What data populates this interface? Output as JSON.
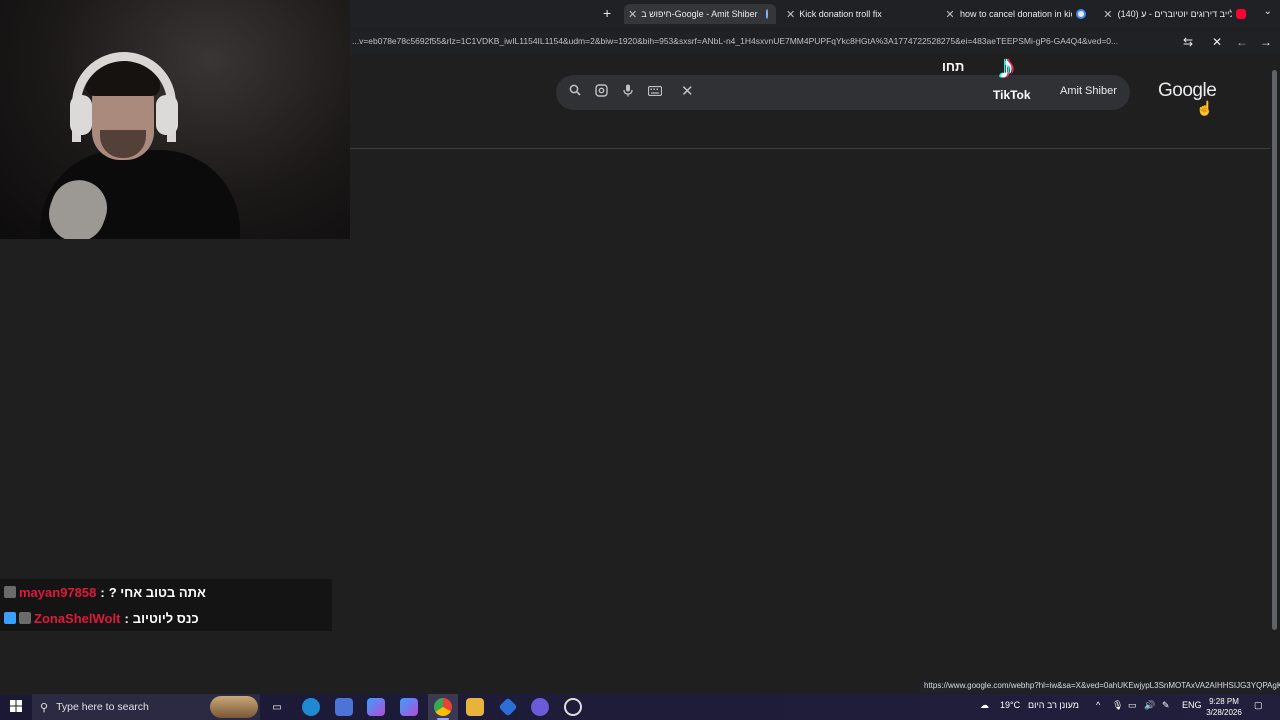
{
  "browser": {
    "tabs": [
      {
        "label": "חיפוש ב-Google - Amit Shiber",
        "active": true
      },
      {
        "label": "Kick donation troll fix",
        "active": false
      },
      {
        "label": "how to cancel donation in kick",
        "active": false
      },
      {
        "label": "(140) לייב דירוגים יוטיוברים - ע...",
        "active": false
      }
    ],
    "url": "...v=eb078e78c5692f55&rlz=1C1VDKB_iwIL1154IL1154&udm=2&biw=1920&bih=953&sxsrf=ANbL-n4_1H4sxvnUE7MM4PUPFqYkc8HGtA%3A1774722528275&ei=483aeTEEPSMi-gP6-GA4Q4&ved=0..."
  },
  "google": {
    "logo": "Google",
    "search_query": "Amit Shiber"
  },
  "overlay": {
    "tiktok_label": "TikTok",
    "tiktok_hebrew": "תחו"
  },
  "chat": {
    "messages": [
      {
        "user": "mayan97858",
        "text": "אתה בטוב אחי ?"
      },
      {
        "user": "ZonaShelWolt",
        "text": "כנס ליוטיוב"
      }
    ]
  },
  "status_link": "https://www.google.com/webhp?hl=iw&sa=X&ved=0ahUKEwjypL3SnMOTAxVA2AIHHSIJG3YQPAgK",
  "taskbar": {
    "search_placeholder": "Type here to search",
    "weather": "19°C",
    "weather_text": "מעונן רב היום",
    "lang": "ENG",
    "time": "9:28 PM",
    "date": "3/28/2026"
  },
  "icons": {
    "search": "search-icon",
    "lens": "google-lens-icon",
    "mic": "mic-icon",
    "keyboard": "keyboard-icon",
    "clear": "clear-icon"
  }
}
